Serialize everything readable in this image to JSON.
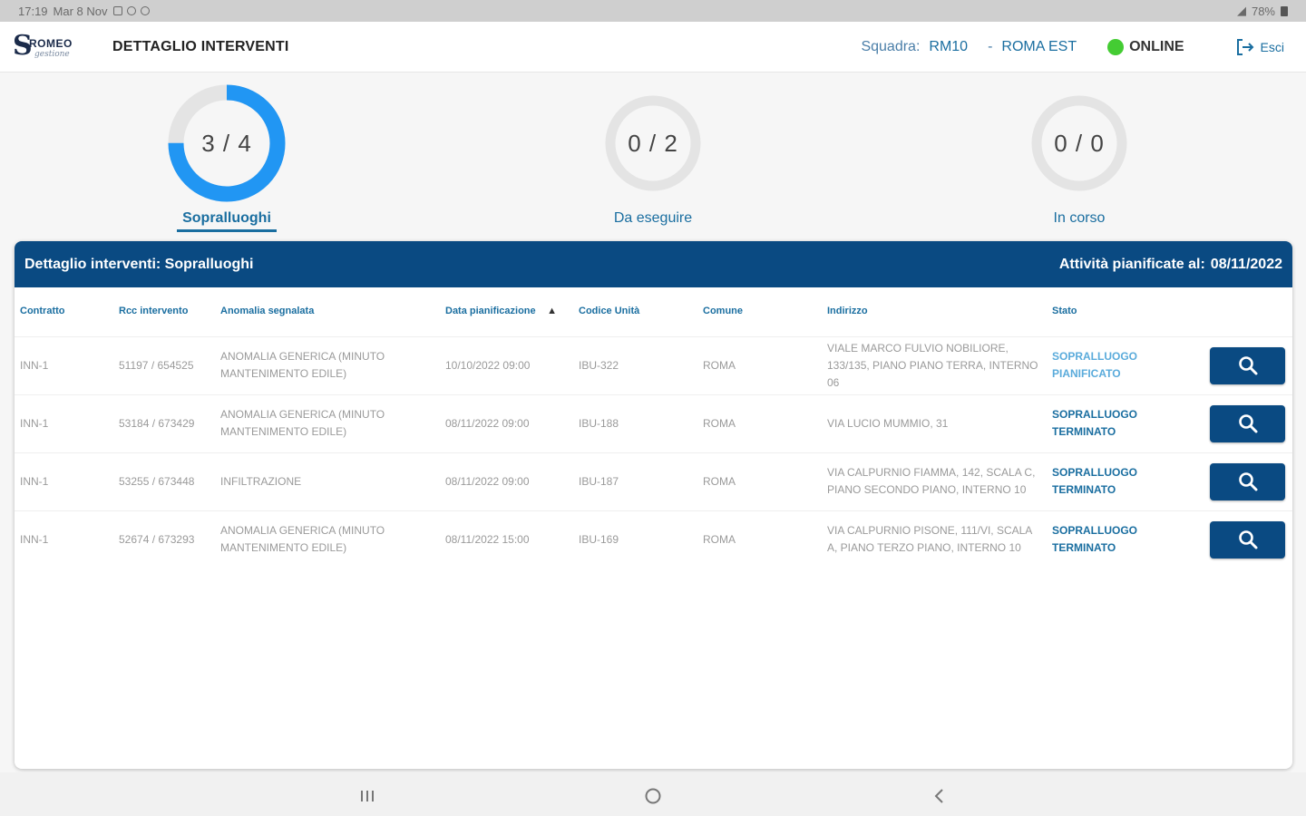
{
  "status_bar": {
    "time": "17:19",
    "date": "Mar 8 Nov",
    "battery": "78%"
  },
  "header": {
    "logo_name": "ROMEO",
    "logo_sub": "gestione",
    "title": "DETTAGLIO INTERVENTI",
    "squadra_label": "Squadra:",
    "squadra_code": "RM10",
    "separator": "-",
    "area": "ROMA EST",
    "status": "ONLINE",
    "status_color": "#44cc33",
    "exit_label": "Esci"
  },
  "summary": [
    {
      "count": "3 / 4",
      "label": "Sopralluoghi",
      "done": 3,
      "total": 4,
      "active": true
    },
    {
      "count": "0 / 2",
      "label": "Da eseguire",
      "done": 0,
      "total": 2,
      "active": false
    },
    {
      "count": "0 / 0",
      "label": "In corso",
      "done": 0,
      "total": 0,
      "active": false
    }
  ],
  "panel": {
    "title": "Dettaglio interventi: Sopralluoghi",
    "planned_label": "Attività pianificate al:",
    "planned_date": "08/11/2022"
  },
  "table": {
    "columns": [
      "Contratto",
      "Rcc intervento",
      "Anomalia segnalata",
      "Data pianificazione",
      "Codice Unità",
      "Comune",
      "Indirizzo",
      "Stato"
    ],
    "sort_indicator": "▲",
    "rows": [
      {
        "contratto": "INN-1",
        "rcc": "51197 / 654525",
        "anomalia": "ANOMALIA GENERICA (MINUTO MANTENIMENTO EDILE)",
        "data": "10/10/2022 09:00",
        "codice": "IBU-322",
        "comune": "ROMA",
        "indirizzo": "VIALE MARCO FULVIO NOBILIORE, 133/135, piano PIANO TERRA, interno 06",
        "stato": "SOPRALLUOGO PIANIFICATO",
        "stato_kind": "planned"
      },
      {
        "contratto": "INN-1",
        "rcc": "53184 / 673429",
        "anomalia": "ANOMALIA GENERICA (MINUTO MANTENIMENTO EDILE)",
        "data": "08/11/2022 09:00",
        "codice": "IBU-188",
        "comune": "ROMA",
        "indirizzo": "VIA LUCIO MUMMIO, 31",
        "stato": "SOPRALLUOGO TERMINATO",
        "stato_kind": "done"
      },
      {
        "contratto": "INN-1",
        "rcc": "53255 / 673448",
        "anomalia": "INFILTRAZIONE",
        "data": "08/11/2022 09:00",
        "codice": "IBU-187",
        "comune": "ROMA",
        "indirizzo": "VIA CALPURNIO FIAMMA, 142, scala C, piano SECONDO PIANO, interno 10",
        "stato": "SOPRALLUOGO TERMINATO",
        "stato_kind": "done"
      },
      {
        "contratto": "INN-1",
        "rcc": "52674 / 673293",
        "anomalia": "ANOMALIA GENERICA (MINUTO MANTENIMENTO EDILE)",
        "data": "08/11/2022 15:00",
        "codice": "IBU-169",
        "comune": "ROMA",
        "indirizzo": "VIA CALPURNIO PISONE, 111/VI, scala A, piano TERZO PIANO, interno 10",
        "stato": "SOPRALLUOGO TERMINATO",
        "stato_kind": "done"
      }
    ]
  },
  "colors": {
    "primary": "#0a4a82",
    "accent": "#2196f3",
    "link": "#1a6ea0"
  }
}
